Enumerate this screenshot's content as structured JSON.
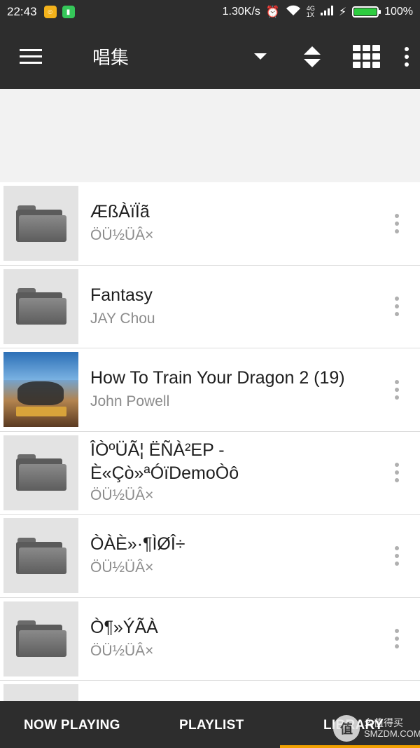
{
  "status": {
    "time": "22:43",
    "speed": "1.30K/s",
    "battery": "100%",
    "net_labels": [
      "4G",
      "1X"
    ]
  },
  "appbar": {
    "title": "唱集"
  },
  "items": [
    {
      "title": "ÆßÀïÏã",
      "subtitle": "ÖÜ½ÜÂ×",
      "thumb": "folder-icon"
    },
    {
      "title": "Fantasy",
      "subtitle": "JAY Chou",
      "thumb": "folder-icon"
    },
    {
      "title": "How To Train Your Dragon 2 (19)",
      "subtitle": "John Powell",
      "thumb": "album-art"
    },
    {
      "title": "ÎÒºÜÃ¦ ËÑÀ²EP -",
      "title2": "È«Çò»ªÓïDemoÒô",
      "subtitle": "ÖÜ½ÜÂ×",
      "thumb": "folder-icon"
    },
    {
      "title": "ÒÀÈ»·¶ÌØÎ÷",
      "subtitle": "ÖÜ½ÜÂ×",
      "thumb": "folder-icon"
    },
    {
      "title": "Ò¶»ÝÃÀ",
      "subtitle": "ÖÜ½ÜÂ×",
      "thumb": "folder-icon"
    }
  ],
  "nav": {
    "now_playing": "NOW PLAYING",
    "playlist": "PLAYLIST",
    "library": "LIBRARY",
    "active": "library"
  },
  "watermark": {
    "glyph": "值",
    "line1": "么值得买",
    "line2": "SMZDM.COM"
  },
  "colors": {
    "bar": "#2d2d2d",
    "accent": "#f0a000",
    "background": "#f2f2f2"
  }
}
